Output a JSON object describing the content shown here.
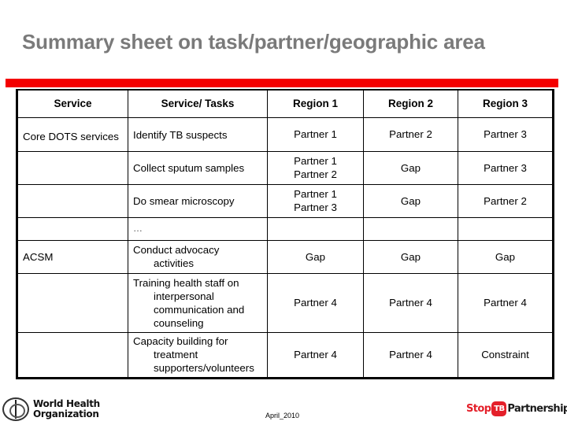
{
  "title": "Summary sheet on task/partner/geographic area",
  "colors": {
    "title": "#7a7a7a",
    "accent_bar": "#f40000",
    "stop_tb_red": "#e4202a"
  },
  "table": {
    "headers": [
      "Service",
      "Service/ Tasks",
      "Region 1",
      "Region 2",
      "Region 3"
    ],
    "rows": [
      {
        "service": "Core DOTS services",
        "task": [
          "Identify TB suspects"
        ],
        "region1": [
          "Partner 1"
        ],
        "region2": [
          "Partner 2"
        ],
        "region3": [
          "Partner 3"
        ]
      },
      {
        "service": "",
        "task": [
          "Collect sputum samples"
        ],
        "region1": [
          "Partner 1",
          "Partner 2"
        ],
        "region2": [
          "Gap"
        ],
        "region3": [
          "Partner 3"
        ]
      },
      {
        "service": "",
        "task": [
          "Do smear microscopy"
        ],
        "region1": [
          "Partner 1",
          "Partner 3"
        ],
        "region2": [
          "Gap"
        ],
        "region3": [
          "Partner 2"
        ]
      },
      {
        "service": "",
        "task": [
          "…"
        ],
        "region1": [],
        "region2": [],
        "region3": []
      },
      {
        "service": "ACSM",
        "task": [
          "Conduct advocacy activities"
        ],
        "region1": [
          "Gap"
        ],
        "region2": [
          "Gap"
        ],
        "region3": [
          "Gap"
        ]
      },
      {
        "service": "",
        "task": [
          "Training health staff on interpersonal communication and counseling"
        ],
        "region1": [
          "Partner 4"
        ],
        "region2": [
          "Partner 4"
        ],
        "region3": [
          "Partner 4"
        ]
      },
      {
        "service": "",
        "task": [
          "Capacity building for treatment supporters/volunteers"
        ],
        "region1": [
          "Partner 4"
        ],
        "region2": [
          "Partner 4"
        ],
        "region3": [
          "Constraint"
        ]
      }
    ]
  },
  "footer": {
    "who_logo": {
      "icon": "who-emblem-icon",
      "line1": "World Health",
      "line2": "Organization"
    },
    "date": "April_2010",
    "stop_tb_logo": {
      "stop": "Stop",
      "tb": "TB",
      "partnership": "Partnership"
    }
  }
}
